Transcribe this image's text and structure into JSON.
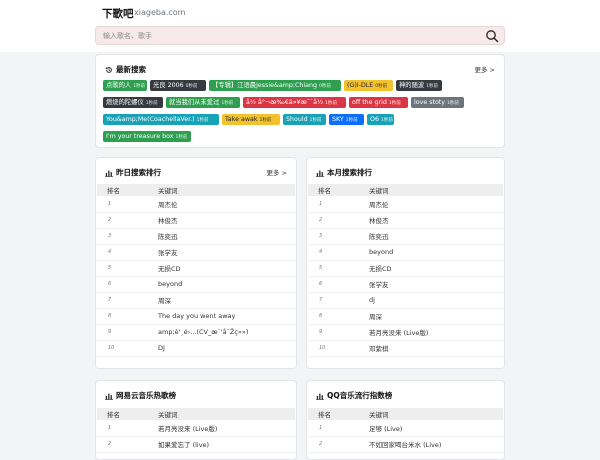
{
  "header": {
    "logo": "下歌吧",
    "domain": "xiageba.com",
    "search_placeholder": "输入歌名、歌手"
  },
  "recent": {
    "title": "最新搜索",
    "more": "更多 >",
    "tags": [
      {
        "label": "点歌的人",
        "count": "1秒前",
        "color": "green"
      },
      {
        "label": "光良 2006",
        "count": "0秒前",
        "color": "dark"
      },
      {
        "label": "【专辑】江语晨Jessie&amp;Chiang",
        "count": "0秒前",
        "color": "green"
      },
      {
        "label": "(G)I-DLE",
        "count": "0秒前",
        "color": "yellow"
      },
      {
        "label": "神的随波",
        "count": "1秒前",
        "color": "dark"
      },
      {
        "label": "燃烧的陀螺仪",
        "count": "1秒前",
        "color": "dark"
      },
      {
        "label": "就当我们从未爱过",
        "count": "1秒前",
        "color": "green"
      },
      {
        "label": "å½ å°¬æ‰€ä»¥æ˜¯å½",
        "count": "1秒前",
        "color": "red"
      },
      {
        "label": "off the grid",
        "count": "1秒前",
        "color": "red"
      },
      {
        "label": "love stoty",
        "count": "1秒前",
        "color": "gray"
      },
      {
        "label": "You&amp;Me(CoachellaVer.)",
        "count": "1秒前",
        "color": "cyan"
      },
      {
        "label": "Take awak",
        "count": "1秒前",
        "color": "yellow"
      },
      {
        "label": "Should",
        "count": "1秒前",
        "color": "cyan"
      },
      {
        "label": "SKY",
        "count": "1秒前",
        "color": "blue"
      },
      {
        "label": "O6",
        "count": "1秒前",
        "color": "cyan"
      },
      {
        "label": "I'm your treasure box",
        "count": "1秒前",
        "color": "green"
      }
    ]
  },
  "yesterday": {
    "title": "昨日搜索排行",
    "more": "更多 >",
    "col_rank": "排名",
    "col_kw": "关键词",
    "rows": [
      {
        "rank": "1",
        "kw": "周杰伦"
      },
      {
        "rank": "2",
        "kw": "林俊杰"
      },
      {
        "rank": "3",
        "kw": "陈奕迅"
      },
      {
        "rank": "4",
        "kw": "张学友"
      },
      {
        "rank": "5",
        "kw": "无损CD"
      },
      {
        "rank": "6",
        "kw": "beyond"
      },
      {
        "rank": "7",
        "kw": "周深"
      },
      {
        "rank": "8",
        "kw": "The day you went away"
      },
      {
        "rank": "9",
        "kw": "amp;è'¸é›...(CV_æ`'å¯Žç»»)"
      },
      {
        "rank": "10",
        "kw": "DJ"
      }
    ]
  },
  "month": {
    "title": "本月搜索排行",
    "col_rank": "排名",
    "col_kw": "关键词",
    "rows": [
      {
        "rank": "1",
        "kw": "周杰伦"
      },
      {
        "rank": "2",
        "kw": "林俊杰"
      },
      {
        "rank": "3",
        "kw": "陈奕迅"
      },
      {
        "rank": "4",
        "kw": "beyond"
      },
      {
        "rank": "5",
        "kw": "无损CD"
      },
      {
        "rank": "6",
        "kw": "张学友"
      },
      {
        "rank": "7",
        "kw": "dj"
      },
      {
        "rank": "8",
        "kw": "周深"
      },
      {
        "rank": "9",
        "kw": "若月亮没来 (Live版)"
      },
      {
        "rank": "10",
        "kw": "邓紫棋"
      }
    ]
  },
  "netease": {
    "title": "网易云音乐热歌榜",
    "col_rank": "排名",
    "col_kw": "关键词",
    "rows": [
      {
        "rank": "1",
        "kw": "若月亮没来 (Live版)"
      },
      {
        "rank": "2",
        "kw": "如果爱忘了 (live)"
      }
    ]
  },
  "qq": {
    "title": "QQ音乐流行指数榜",
    "col_rank": "排名",
    "col_kw": "关键词",
    "rows": [
      {
        "rank": "1",
        "kw": "足够 (Live)"
      },
      {
        "rank": "2",
        "kw": "不如回家喝台米水 (Live)"
      }
    ]
  }
}
